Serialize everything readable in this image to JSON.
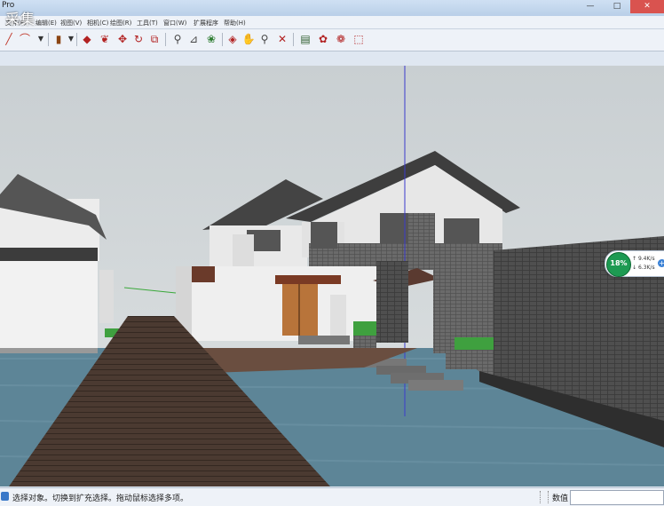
{
  "window": {
    "title": "Pro",
    "watermark": "采集",
    "buttons": [
      "—",
      "□",
      "✕"
    ]
  },
  "menubar": {
    "items": [
      "文件(F)",
      "编辑(E)",
      "视图(V)",
      "相机(C)",
      "绘图(R)",
      "工具(T)",
      "窗口(W)",
      "扩展程序",
      "帮助(H)"
    ]
  },
  "toolbar": {
    "icons": [
      "line-tool-icon",
      "arc-tool-icon",
      "shape-tool-icon",
      "pushpull-icon",
      "followme-icon",
      "move-icon",
      "rotate-icon",
      "scale-icon",
      "tape-measure-icon",
      "dimension-icon",
      "paint-bucket-icon",
      "orbit-icon",
      "pan-icon",
      "zoom-icon",
      "zoom-extents-icon",
      "components-icon",
      "materials-icon",
      "styles-icon",
      "layers-icon"
    ]
  },
  "statusbar": {
    "hint": "选择对象。切换到扩充选择。拖动鼠标选择多项。",
    "measure_label": "数值",
    "measure_value": ""
  },
  "net_widget": {
    "percent": "18%",
    "up": "9.4K/s",
    "down": "6.3K/s",
    "up_arrow": "↑",
    "down_arrow": "↓",
    "plus": "+"
  },
  "colors": {
    "accent": "#1d9a52",
    "sky": "#d4dadc",
    "water": "#587f92",
    "deck": "#4a3a30"
  }
}
